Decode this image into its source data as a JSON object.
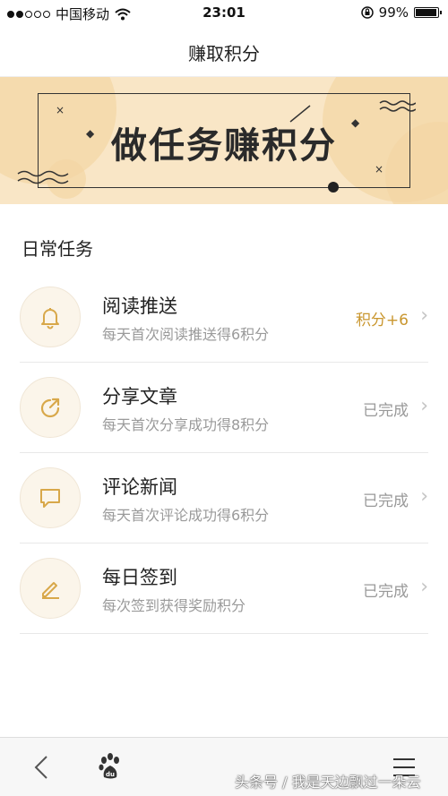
{
  "status_bar": {
    "carrier": "中国移动",
    "time": "23:01",
    "battery": "99%"
  },
  "nav": {
    "title": "赚取积分"
  },
  "banner": {
    "text": "做任务赚积分"
  },
  "section": {
    "title": "日常任务"
  },
  "tasks": [
    {
      "name": "阅读推送",
      "desc": "每天首次阅读推送得6积分",
      "status": "积分+6",
      "icon": "bell-icon"
    },
    {
      "name": "分享文章",
      "desc": "每天首次分享成功得8积分",
      "status": "已完成",
      "icon": "share-icon"
    },
    {
      "name": "评论新闻",
      "desc": "每天首次评论成功得6积分",
      "status": "已完成",
      "icon": "comment-icon"
    },
    {
      "name": "每日签到",
      "desc": "每次签到获得奖励积分",
      "status": "已完成",
      "icon": "pen-icon"
    }
  ],
  "watermark": "头条号 / 我是天边飘过一朵云",
  "colors": {
    "accent": "#c9962e",
    "banner_bg": "#f9e6c6",
    "icon_bg": "#fbf5ea",
    "icon_stroke": "#d8a84a"
  }
}
